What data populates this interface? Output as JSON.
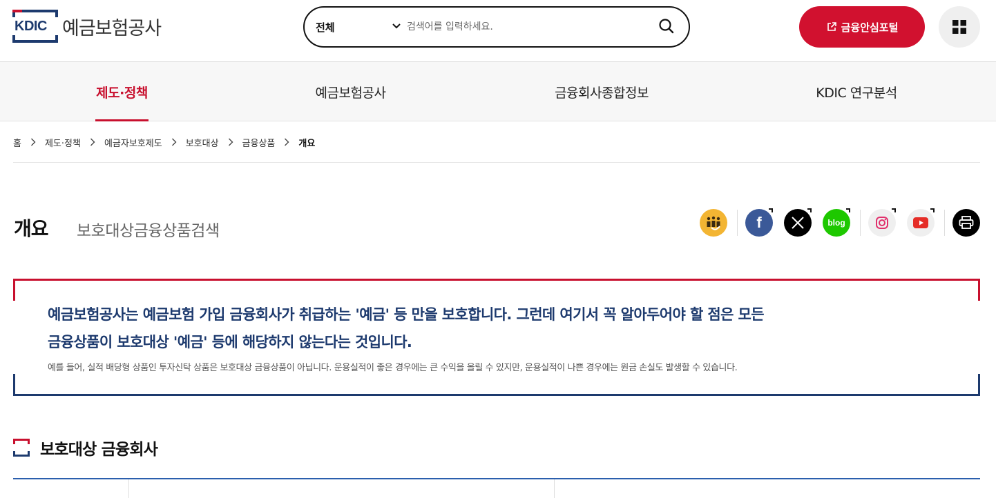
{
  "header": {
    "logo_mark": "KDIC",
    "logo_name": "예금보험공사",
    "search": {
      "scope": "전체",
      "placeholder": "검색어를 입력하세요."
    },
    "portal_label": "금융안심포털"
  },
  "gnb": {
    "items": [
      {
        "label": "제도·정책",
        "active": true
      },
      {
        "label": "예금보험공사",
        "active": false
      },
      {
        "label": "금융회사종합정보",
        "active": false
      },
      {
        "label": "KDIC 연구분석",
        "active": false
      }
    ]
  },
  "breadcrumb": [
    "홈",
    "제도·정책",
    "예금자보호제도",
    "보호대상",
    "금융상품",
    "개요"
  ],
  "page": {
    "title": "개요",
    "subtitle": "보호대상금융상품검색"
  },
  "share": {
    "icons": [
      "kdic-character-icon",
      "facebook-icon",
      "x-icon",
      "blog-icon",
      "instagram-icon",
      "youtube-icon",
      "print-icon"
    ],
    "blog_label": "blog",
    "facebook_label": "f"
  },
  "intro": {
    "lead_line1": "예금보험공사는 예금보험 가입 금융회사가 취급하는 '예금' 등 만을 보호합니다. 그런데 여기서 꼭 알아두어야 할 점은 모든",
    "lead_line2": "금융상품이 보호대상 '예금' 등에 해당하지 않는다는 것입니다.",
    "desc": "예를 들어, 실적 배당형 상품인 투자신탁 상품은 보호대상 금융상품이 아닙니다. 운용실적이 좋은 경우에는 큰 수익을 올릴 수 있지만, 운용실적이 나쁜 경우에는 원금 손실도 발생할 수 있습니다."
  },
  "section": {
    "title": "보호대상 금융회사"
  },
  "colors": {
    "brand_red": "#c8102e",
    "brand_navy": "#1d3a6e",
    "portal_red": "#d1112f",
    "table_blue": "#2b5fad"
  }
}
